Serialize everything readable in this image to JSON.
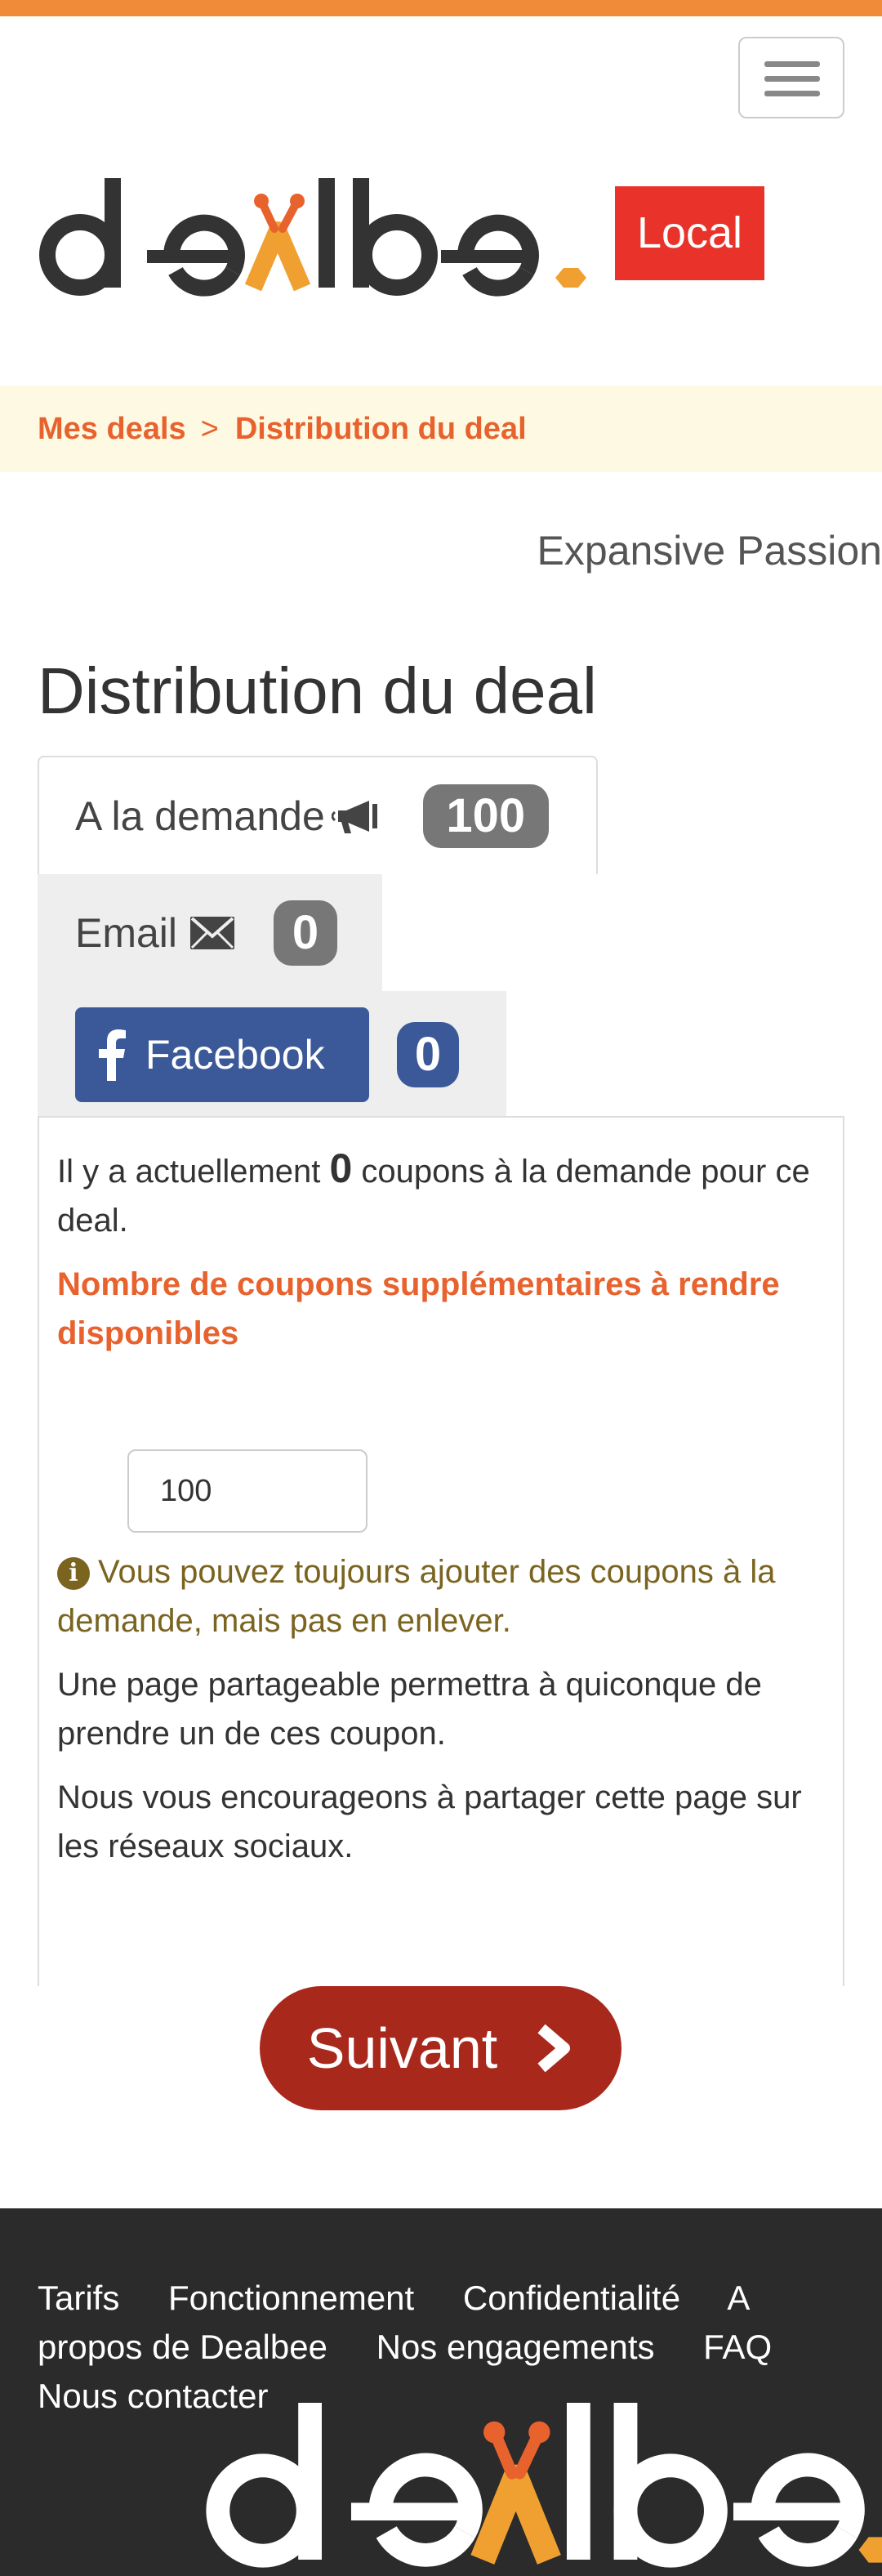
{
  "header": {
    "menu_toggle": "hamburger-menu",
    "brand_name": "dealbee",
    "badge": "Local"
  },
  "breadcrumb": {
    "items": [
      "Mes deals",
      "Distribution du deal"
    ],
    "separator": ">"
  },
  "company_name": "Expansive Passion",
  "page_title": "Distribution du deal",
  "tabs": [
    {
      "label": "A la demande",
      "icon": "megaphone-icon",
      "count": "100"
    },
    {
      "label": "Email",
      "icon": "envelope-icon",
      "count": "0"
    },
    {
      "label": "Facebook",
      "icon": "facebook-icon",
      "count": "0"
    }
  ],
  "panel": {
    "intro_before": "Il y a actuellement ",
    "intro_count": "0",
    "intro_after": " coupons à la demande pour ce deal.",
    "quantity_label": "Nombre de coupons supplémentaires à rendre disponibles",
    "quantity_value": "100",
    "info_note": "Vous pouvez toujours ajouter des coupons à la demande, mais pas en enlever.",
    "paragraph_1": "Une page partageable permettra à quiconque de prendre un de ces coupon.",
    "paragraph_2": "Nous vous encourageons à partager cette page sur les réseaux sociaux."
  },
  "next_button": {
    "label": "Suivant",
    "icon": "chevron-right-icon"
  },
  "footer": {
    "links": [
      "Tarifs",
      "Fonctionnement",
      "Confidentialité",
      "A propos de Dealbee",
      "Nos engagements",
      "FAQ",
      "Nous contacter"
    ],
    "brand_name": "dealbee"
  },
  "colors": {
    "accent_orange": "#E8622E",
    "top_strip": "#F08B3A",
    "badge_red": "#E8322A",
    "facebook_blue": "#3B5998",
    "next_button": "#A8281C",
    "footer_bg": "#2B2B2B",
    "breadcrumb_bg": "#FEF9E2"
  }
}
